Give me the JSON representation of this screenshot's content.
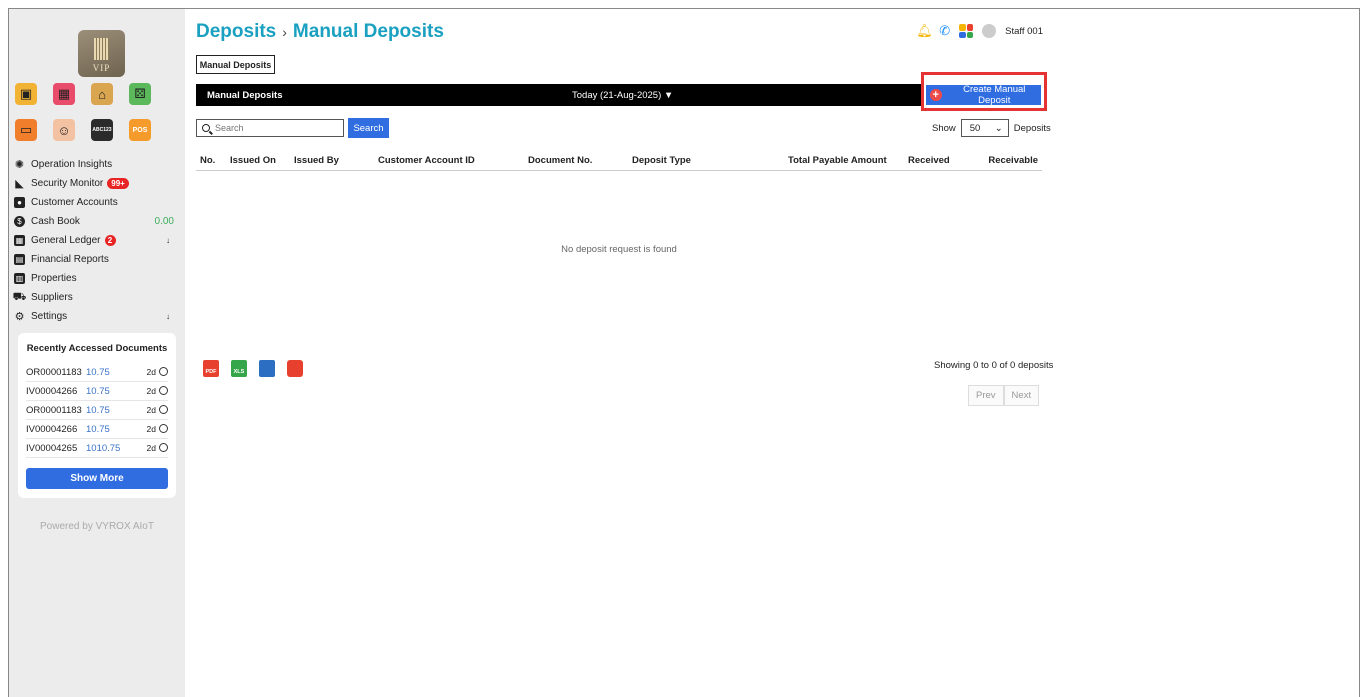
{
  "sidebar": {
    "logo_text": "VIP",
    "nav": [
      {
        "label": "Operation Insights"
      },
      {
        "label": "Security Monitor",
        "badge": "99+"
      },
      {
        "label": "Customer Accounts"
      },
      {
        "label": "Cash Book",
        "value": "0.00"
      },
      {
        "label": "General Ledger",
        "badge": "2",
        "arrow": "↓"
      },
      {
        "label": "Financial Reports"
      },
      {
        "label": "Properties"
      },
      {
        "label": "Suppliers"
      },
      {
        "label": "Settings",
        "arrow": "↓"
      }
    ],
    "recent": {
      "title": "Recently Accessed Documents",
      "rows": [
        {
          "doc": "OR00001183",
          "amount": "10.75",
          "age": "2d"
        },
        {
          "doc": "IV00004266",
          "amount": "10.75",
          "age": "2d"
        },
        {
          "doc": "OR00001183",
          "amount": "10.75",
          "age": "2d"
        },
        {
          "doc": "IV00004266",
          "amount": "10.75",
          "age": "2d"
        },
        {
          "doc": "IV00004265",
          "amount": "1010.75",
          "age": "2d"
        }
      ],
      "show_more": "Show More"
    },
    "powered_by": "Powered by VYROX AIoT",
    "app_icons": [
      "kiosk-icon",
      "calendar-icon",
      "bank-icon",
      "dice-icon",
      "card-icon",
      "face-scan-icon",
      "abc-icon",
      "pos-icon"
    ],
    "pos_label": "POS",
    "abc_label": "ABC123"
  },
  "header": {
    "breadcrumb_parent": "Deposits",
    "breadcrumb_sep": "›",
    "breadcrumb_current": "Manual Deposits",
    "user": "Staff 001"
  },
  "main": {
    "tab_label": "Manual Deposits",
    "bar_label": "Manual Deposits",
    "date_filter": "Today (21-Aug-2025) ▼",
    "create_button": "Create Manual Deposit",
    "search_placeholder": "Search",
    "search_button": "Search",
    "show_label": "Show",
    "page_size": "50",
    "page_size_suffix": "Deposits",
    "columns": [
      "No.",
      "Issued On",
      "Issued By",
      "Customer Account ID",
      "Document No.",
      "Deposit Type",
      "Total Payable Amount",
      "Received",
      "Receivable"
    ],
    "empty_message": "No deposit request is found",
    "showing_text": "Showing 0 to 0 of 0 deposits",
    "prev": "Prev",
    "next": "Next",
    "export_labels": {
      "pdf": "PDF",
      "xls": "XLS"
    }
  },
  "colors": {
    "accent": "#2f6de1",
    "title": "#1aa0c0",
    "highlight": "#e53232"
  }
}
